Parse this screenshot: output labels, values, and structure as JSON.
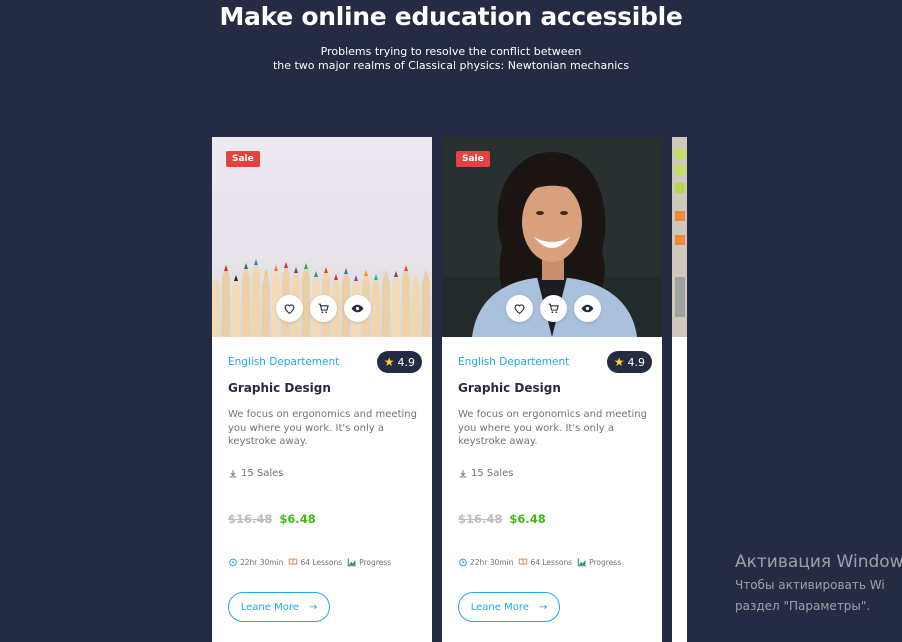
{
  "hero": {
    "title": "Make online education accessible",
    "subtitle_line1": "Problems trying to resolve the conflict between",
    "subtitle_line2": "the two major realms of Classical physics: Newtonian mechanics"
  },
  "colors": {
    "background": "#252b42",
    "accent": "#23a6f0",
    "sale": "#e74040",
    "price_new": "#40bb15",
    "price_old": "#bdbdbd",
    "star": "#ffce31"
  },
  "cards": [
    {
      "badge": "Sale",
      "image": "colored-pencils",
      "department": "English Departement",
      "rating": "4.9",
      "title": "Graphic Design",
      "description": "We focus on ergonomics and meeting you where you work. It's only a keystroke away.",
      "sales": "15 Sales",
      "old_price": "$16.48",
      "new_price": "$6.48",
      "duration": "22hr 30min",
      "lessons": "64 Lessons",
      "progress": "Progress",
      "cta": "Leane More",
      "cta_arrow": "→"
    },
    {
      "badge": "Sale",
      "image": "smiling-woman",
      "department": "English Departement",
      "rating": "4.9",
      "title": "Graphic Design",
      "description": "We focus on ergonomics and meeting you where you work. It's only a keystroke away.",
      "sales": "15 Sales",
      "old_price": "$16.48",
      "new_price": "$6.48",
      "duration": "22hr 30min",
      "lessons": "64 Lessons",
      "progress": "Progress",
      "cta": "Leane More",
      "cta_arrow": "→"
    }
  ],
  "icons": {
    "wishlist": "heart-icon",
    "cart": "cart-icon",
    "view": "eye-icon",
    "rating": "star-icon",
    "sales": "download-icon",
    "duration": "alarm-clock-icon",
    "lessons": "book-icon",
    "progress": "chart-icon",
    "cta": "arrow-right-icon"
  },
  "watermark": {
    "line1": "Активация Window",
    "line2": "Чтобы активировать Wi",
    "line3": "раздел \"Параметры\"."
  }
}
